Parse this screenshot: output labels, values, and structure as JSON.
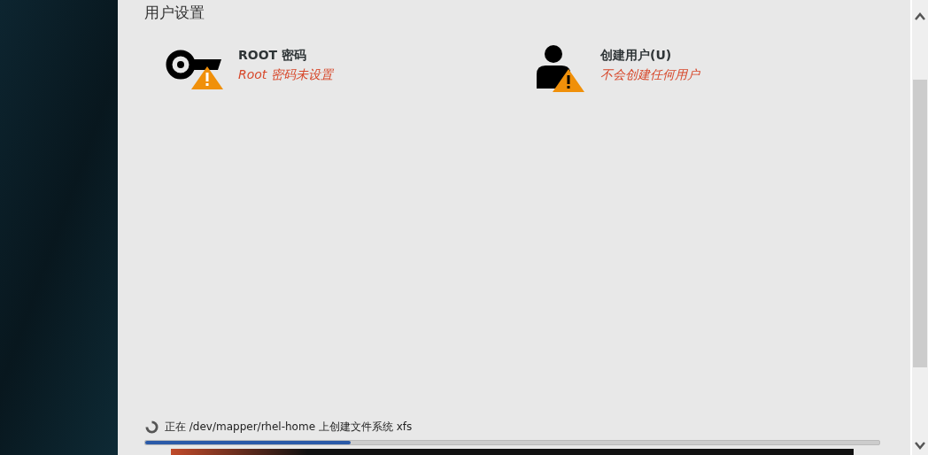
{
  "section_title": "用户设置",
  "spokes": [
    {
      "kind": "key",
      "title": "ROOT 密码",
      "status": "Root 密码未设置",
      "warning": true
    },
    {
      "kind": "user",
      "title": "创建用户(U)",
      "status": "不会创建任何用户",
      "warning": true
    }
  ],
  "progress": {
    "message": "正在 /dev/mapper/rhel-home 上创建文件系统 xfs",
    "level": 0.28
  }
}
